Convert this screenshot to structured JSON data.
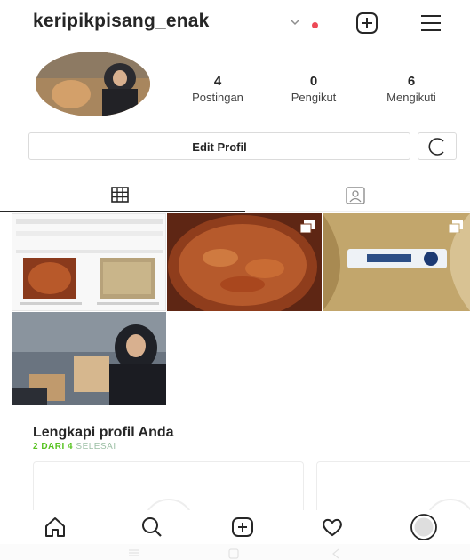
{
  "header": {
    "username": "keripikpisang_enak"
  },
  "profile": {
    "stats": [
      {
        "value": "4",
        "label": "Postingan"
      },
      {
        "value": "0",
        "label": "Pengikut"
      },
      {
        "value": "6",
        "label": "Mengikuti"
      }
    ],
    "edit_button": "Edit Profil"
  },
  "complete_profile": {
    "title": "Lengkapi profil Anda",
    "progress_done": "2 DARI 4",
    "progress_rest": "SELESAI"
  },
  "colors": {
    "accent_green": "#58c322",
    "notification_red": "#ed4956",
    "text_primary": "#262626",
    "border": "#dbdbdb"
  },
  "icons": {
    "header": [
      "chevron-down-icon",
      "new-post-icon",
      "menu-icon"
    ],
    "tabs": [
      "grid-icon",
      "tagged-icon"
    ],
    "bottom_nav": [
      "home-icon",
      "search-icon",
      "new-post-icon",
      "heart-icon",
      "profile-avatar-icon"
    ]
  }
}
